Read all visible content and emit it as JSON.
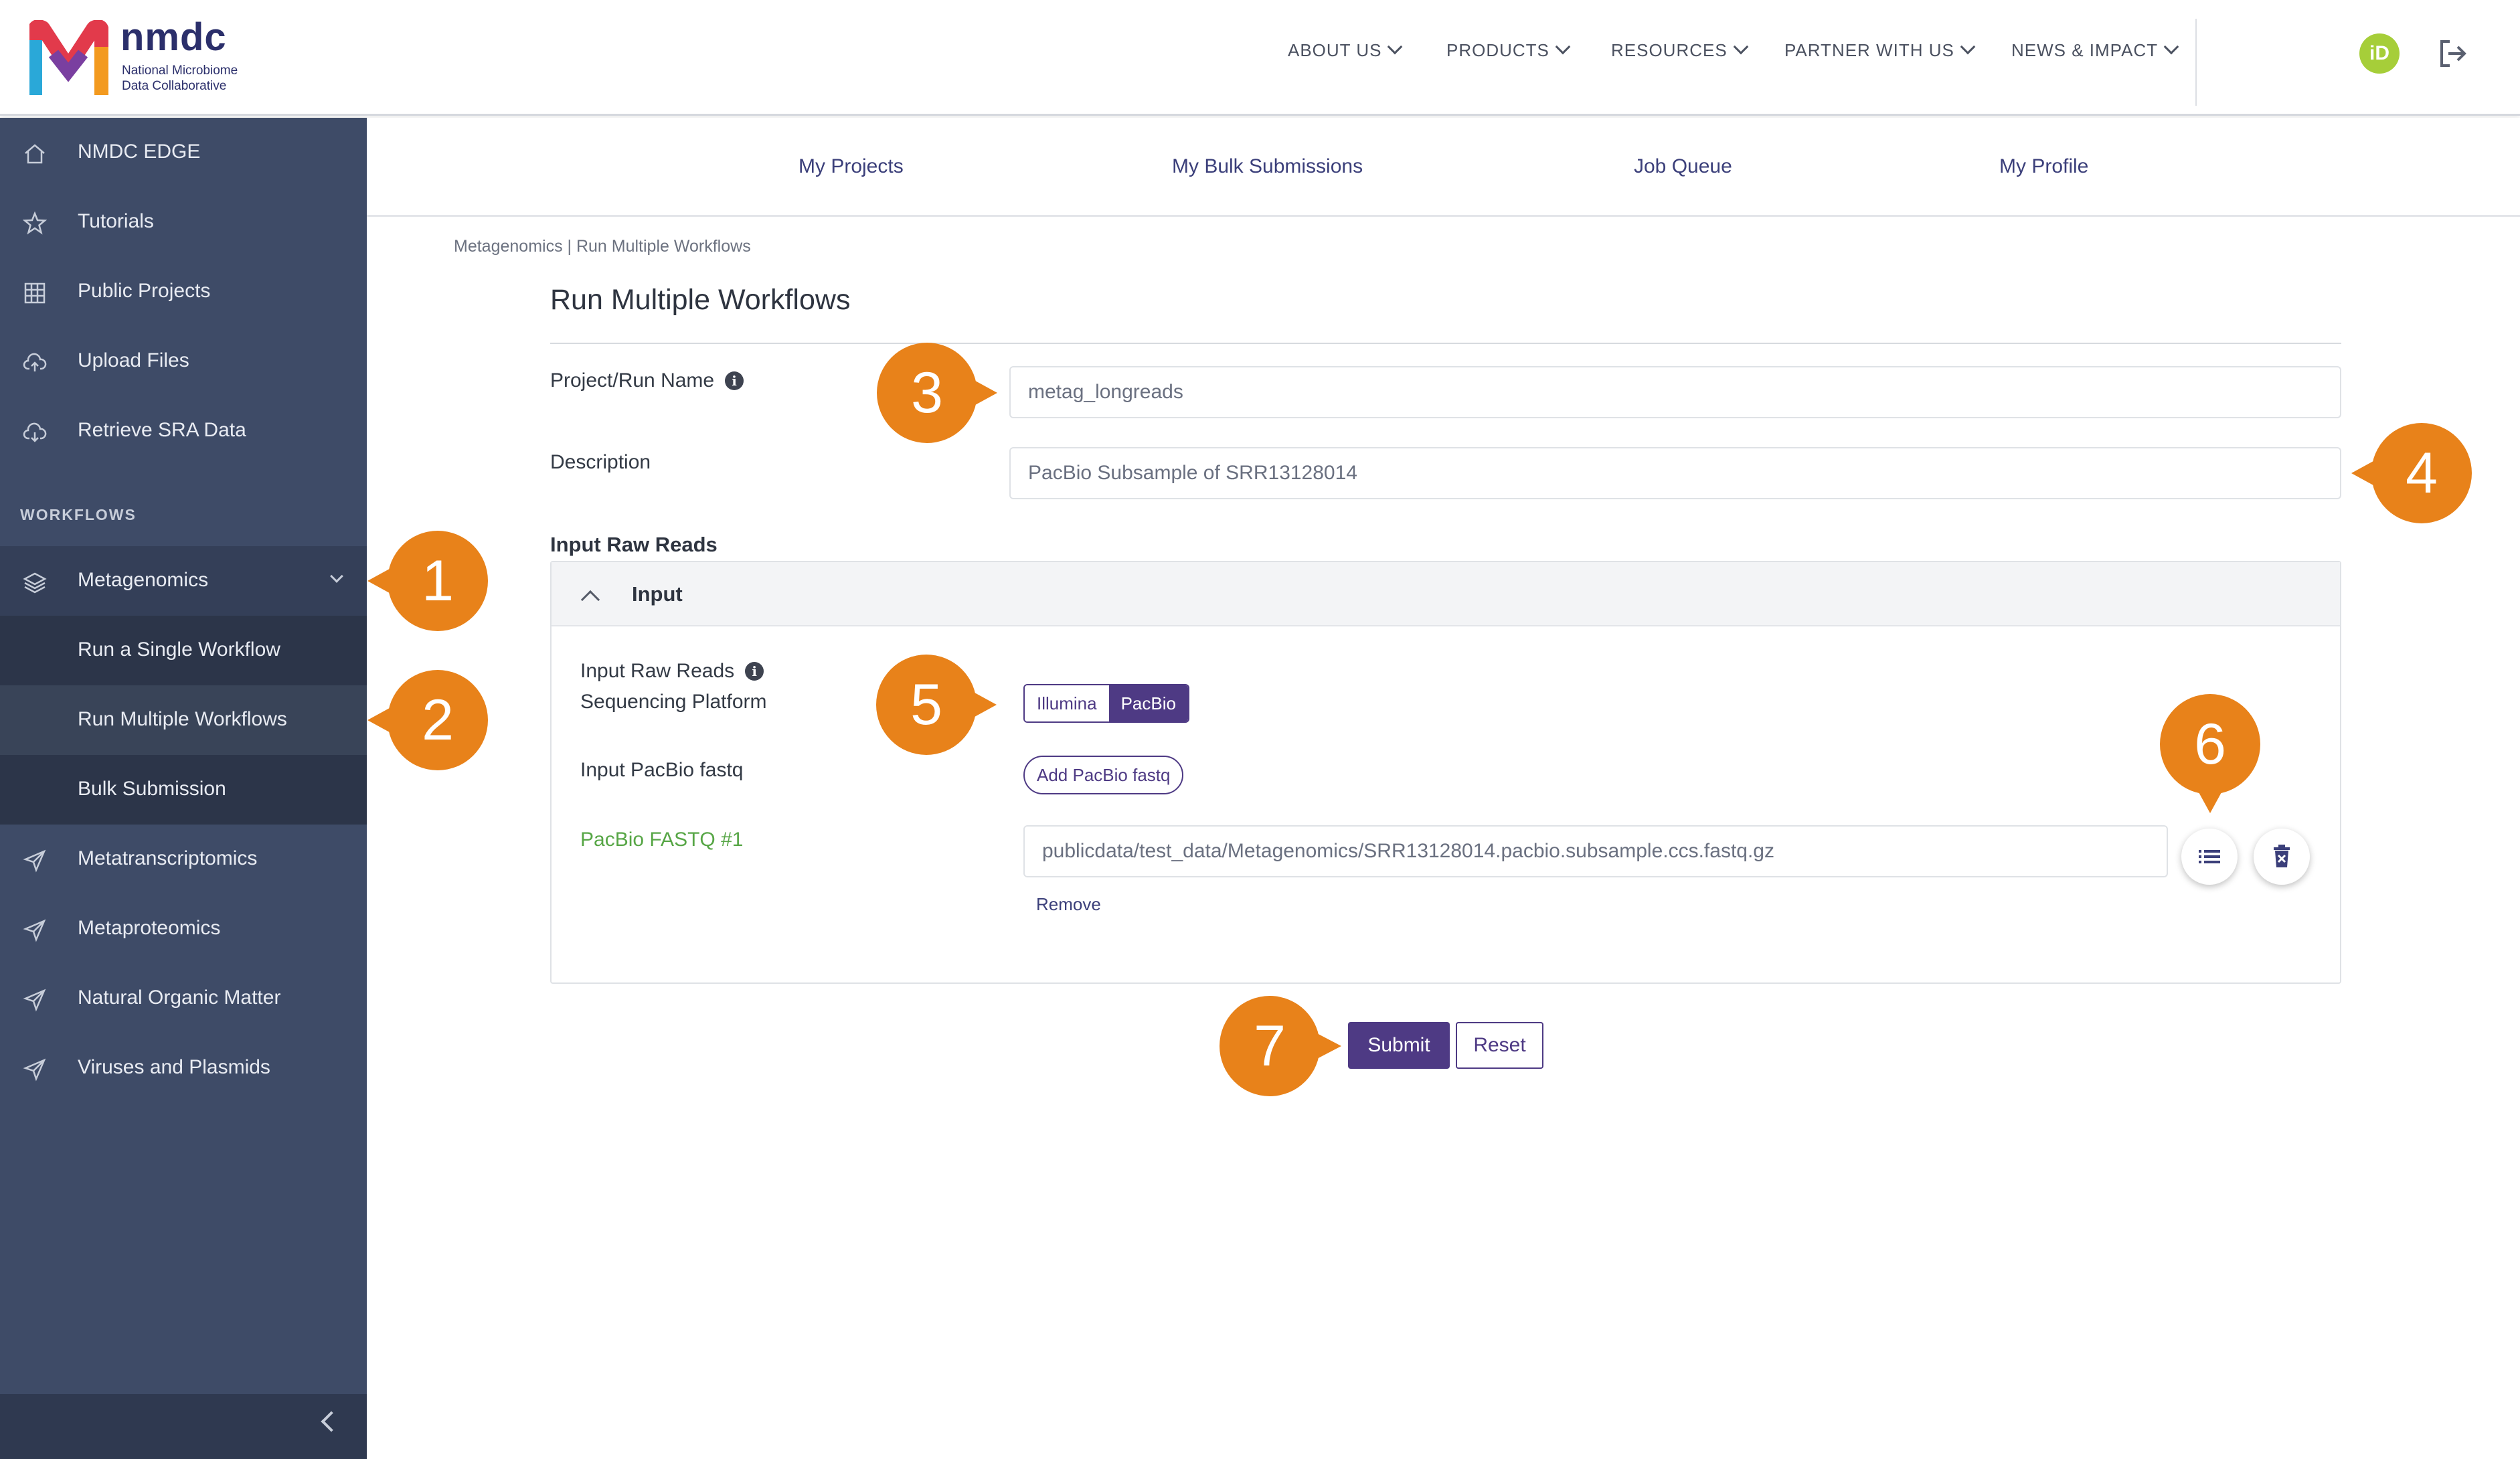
{
  "header": {
    "brand": "nmdc",
    "brand_sub_1": "National Microbiome",
    "brand_sub_2": "Data Collaborative",
    "nav": [
      "ABOUT US",
      "PRODUCTS",
      "RESOURCES",
      "PARTNER WITH US",
      "NEWS & IMPACT"
    ],
    "orcid": "iD"
  },
  "sidebar": {
    "items": [
      "NMDC EDGE",
      "Tutorials",
      "Public Projects",
      "Upload Files",
      "Retrieve SRA Data"
    ],
    "section": "WORKFLOWS",
    "workflows": [
      "Metagenomics",
      "Metatranscriptomics",
      "Metaproteomics",
      "Natural Organic Matter",
      "Viruses and Plasmids"
    ],
    "metagenomics_sub": [
      "Run a Single Workflow",
      "Run Multiple Workflows",
      "Bulk Submission"
    ]
  },
  "subnav": [
    "My Projects",
    "My Bulk Submissions",
    "Job Queue",
    "My Profile"
  ],
  "breadcrumb": "Metagenomics | Run Multiple Workflows",
  "page_title": "Run Multiple Workflows",
  "form": {
    "project_label": "Project/Run Name",
    "project_value": "metag_longreads",
    "description_label": "Description",
    "description_value": "PacBio Subsample of SRR13128014",
    "input_section": "Input Raw Reads",
    "card_title": "Input",
    "platform_label_1": "Input Raw Reads",
    "platform_label_2": "Sequencing Platform",
    "platform_options": [
      "Illumina",
      "PacBio"
    ],
    "platform_selected": "PacBio",
    "fastq_label": "Input PacBio fastq",
    "add_button": "Add PacBio fastq",
    "fastq_item_label": "PacBio FASTQ #1",
    "fastq_item_value": "publicdata/test_data/Metagenomics/SRR13128014.pacbio.subsample.ccs.fastq.gz",
    "remove": "Remove",
    "submit": "Submit",
    "reset": "Reset"
  },
  "callouts": [
    "1",
    "2",
    "3",
    "4",
    "5",
    "6",
    "7"
  ],
  "colors": {
    "sidebar": "#3e4b67",
    "accent": "#4e3a84",
    "callout": "#e8821a",
    "fastq_label": "#57a646"
  }
}
